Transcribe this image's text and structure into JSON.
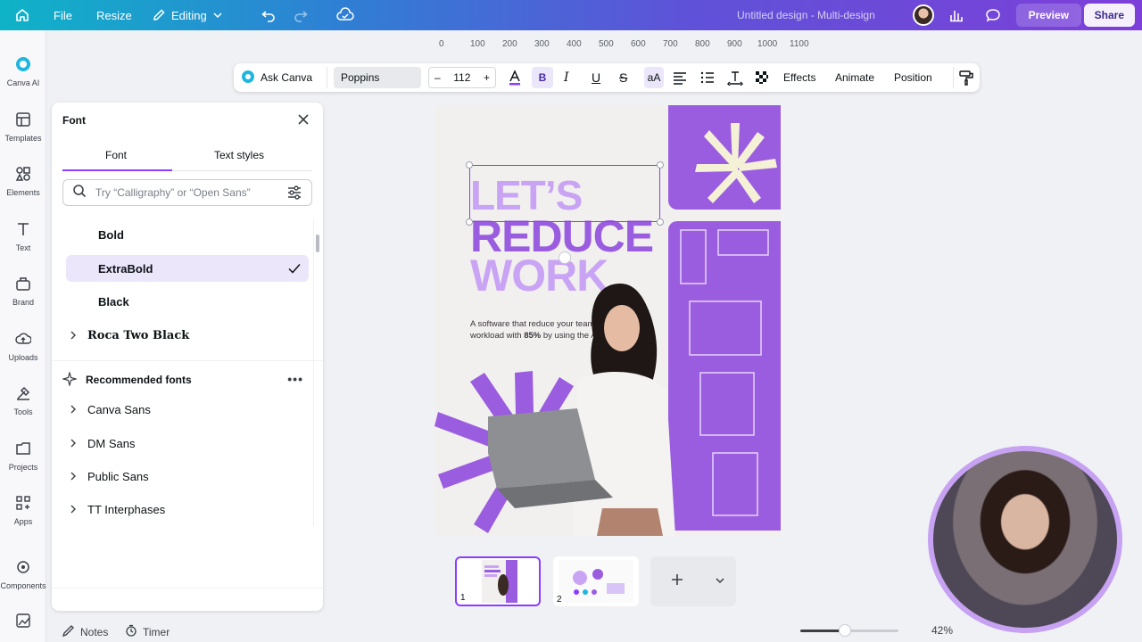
{
  "topbar": {
    "file": "File",
    "resize": "Resize",
    "editing": "Editing",
    "title": "Untitled design - Multi-design",
    "preview": "Preview",
    "share": "Share"
  },
  "rail": [
    {
      "label": "Canva AI",
      "icon": "canva-ai-icon"
    },
    {
      "label": "Templates",
      "icon": "templates-icon"
    },
    {
      "label": "Elements",
      "icon": "elements-icon"
    },
    {
      "label": "Text",
      "icon": "text-icon"
    },
    {
      "label": "Brand",
      "icon": "brand-icon"
    },
    {
      "label": "Uploads",
      "icon": "uploads-icon"
    },
    {
      "label": "Tools",
      "icon": "tools-icon"
    },
    {
      "label": "Projects",
      "icon": "projects-icon"
    },
    {
      "label": "Apps",
      "icon": "apps-icon"
    },
    {
      "label": "Components",
      "icon": "components-icon"
    }
  ],
  "panel": {
    "title": "Font",
    "tabs": [
      "Font",
      "Text styles"
    ],
    "search_placeholder": "Try “Calligraphy” or “Open Sans”",
    "weights": [
      "Bold",
      "ExtraBold",
      "Black"
    ],
    "selected_weight": "ExtraBold",
    "family_roca": "Roca Two Black",
    "recommended_title": "Recommended fonts",
    "recommended": [
      "Canva Sans",
      "DM Sans",
      "Public Sans",
      "TT Interphases"
    ]
  },
  "toolbar": {
    "ask_canva": "Ask Canva",
    "font": "Poppins",
    "size": "112",
    "minus": "–",
    "plus": "+",
    "effects": "Effects",
    "animate": "Animate",
    "position": "Position"
  },
  "ruler": [
    "0",
    "100",
    "200",
    "300",
    "400",
    "500",
    "600",
    "700",
    "800",
    "900",
    "1000",
    "1100"
  ],
  "design": {
    "line1": "LET’S",
    "line2": "REDUCE",
    "line3": "WORK",
    "body_pre": "A software that reduce your team’s workload with ",
    "body_bold": "85%",
    "body_post": " by using the AI."
  },
  "pages": [
    "1",
    "2"
  ],
  "bottombar": {
    "notes": "Notes",
    "timer": "Timer",
    "zoom": "42%"
  },
  "colors": {
    "accent": "#8b3dff",
    "design_purple": "#9b5de0",
    "light_purple": "#c9a4f4"
  }
}
